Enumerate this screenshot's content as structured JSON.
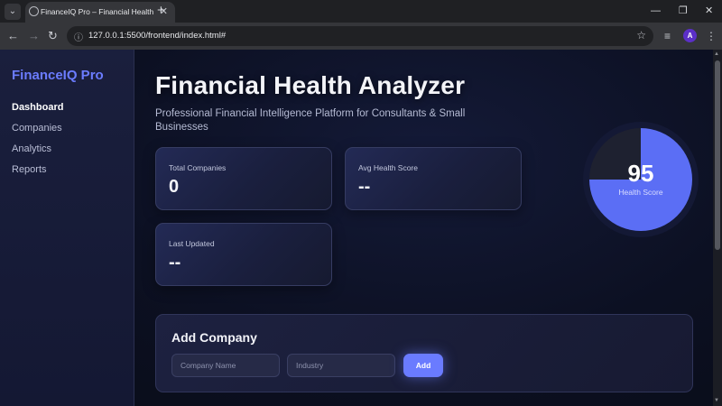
{
  "browser": {
    "tab_search_icon": "chevron-down-icon",
    "tab_title": "FinanceIQ Pro – Financial Health",
    "tab_close": "✕",
    "new_tab": "+",
    "win_minimize": "—",
    "win_restore": "❐",
    "win_close": "✕",
    "back": "←",
    "forward": "→",
    "reload": "↻",
    "url": "127.0.0.1:5500/frontend/index.html#",
    "star": "☆",
    "media": "≡",
    "avatar_initial": "A",
    "menu": "⋮"
  },
  "sidebar": {
    "brand": "FinanceIQ Pro",
    "items": [
      {
        "label": "Dashboard",
        "active": true
      },
      {
        "label": "Companies",
        "active": false
      },
      {
        "label": "Analytics",
        "active": false
      },
      {
        "label": "Reports",
        "active": false
      }
    ]
  },
  "header": {
    "title": "Financial Health Analyzer",
    "subtitle": "Professional Financial Intelligence Platform for Consultants & Small Businesses"
  },
  "stats": [
    {
      "label": "Total Companies",
      "value": "0"
    },
    {
      "label": "Avg Health Score",
      "value": "--"
    },
    {
      "label": "Last Updated",
      "value": "--"
    }
  ],
  "health_gauge": {
    "score": "95",
    "label": "Health Score",
    "fill_fraction": 0.75,
    "fill_color": "#5b6ef5",
    "track_color": "#1e2130"
  },
  "add_company": {
    "title": "Add Company",
    "name_placeholder": "Company Name",
    "industry_placeholder": "Industry",
    "button_label": "Add"
  },
  "colors": {
    "accent": "#6a7bff",
    "brand": "#6b7cff"
  }
}
